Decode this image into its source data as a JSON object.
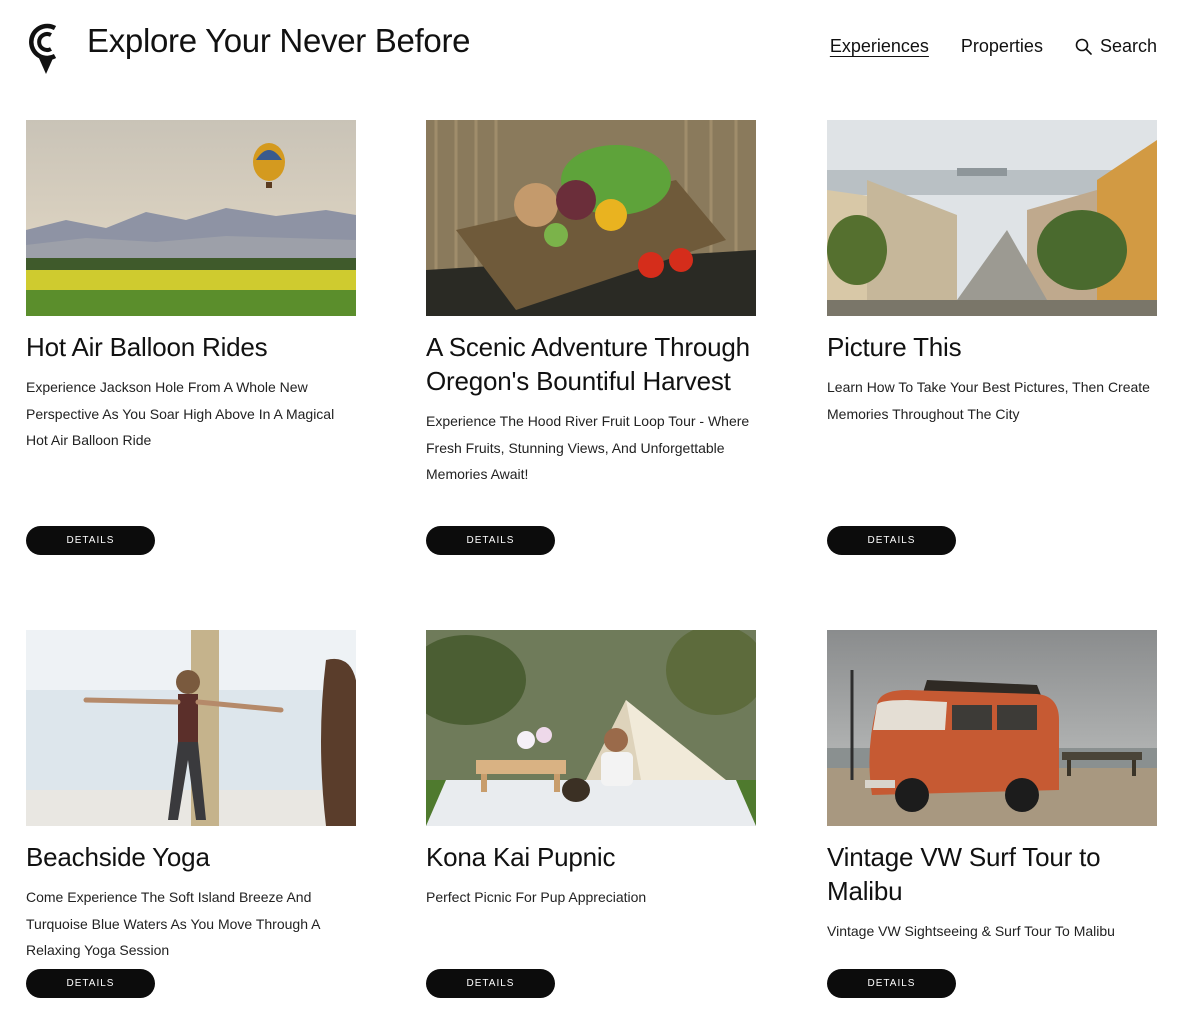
{
  "header": {
    "title": "Explore Your Never Before",
    "nav": {
      "experiences": "Experiences",
      "properties": "Properties",
      "search": "Search"
    }
  },
  "cards": [
    {
      "title": "Hot Air Balloon Rides",
      "description": "Experience Jackson Hole From A Whole New Perspective As You Soar High Above In A Magical Hot Air Balloon Ride",
      "button": "DETAILS"
    },
    {
      "title": "A Scenic Adventure Through Oregon's Bountiful Harvest",
      "description": "Experience The Hood River Fruit Loop Tour - Where Fresh Fruits, Stunning Views, And Unforgettable Memories Await!",
      "button": "DETAILS"
    },
    {
      "title": "Picture This",
      "description": "Learn How To Take Your Best Pictures, Then Create Memories Throughout The City",
      "button": "DETAILS"
    },
    {
      "title": "Beachside Yoga",
      "description": "Come Experience The Soft Island Breeze And Turquoise Blue Waters As You Move Through A Relaxing Yoga Session",
      "button": "DETAILS"
    },
    {
      "title": "Kona Kai Pupnic",
      "description": "Perfect Picnic For Pup Appreciation",
      "button": "DETAILS"
    },
    {
      "title": "Vintage VW Surf Tour to Malibu",
      "description": "Vintage VW Sightseeing & Surf Tour To Malibu",
      "button": "DETAILS"
    }
  ]
}
